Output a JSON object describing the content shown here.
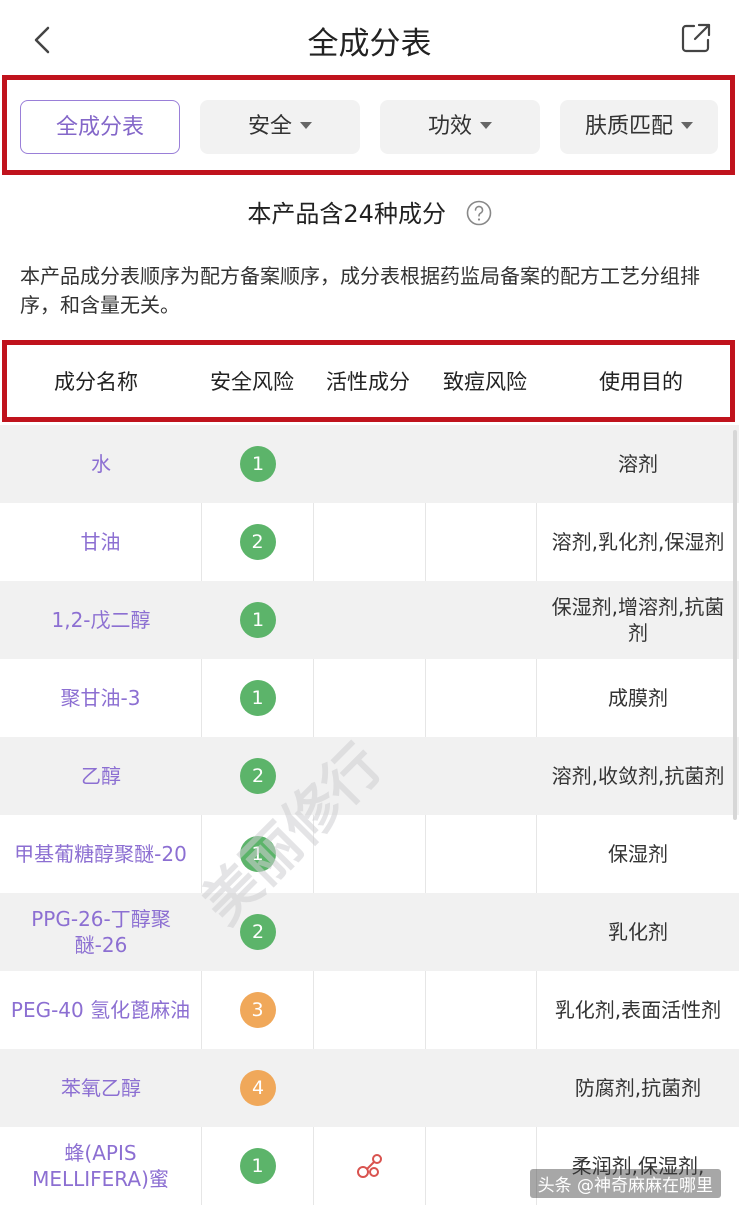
{
  "header": {
    "title": "全成分表"
  },
  "tabs": [
    {
      "label": "全成分表",
      "active": true
    },
    {
      "label": "安全",
      "active": false
    },
    {
      "label": "功效",
      "active": false
    },
    {
      "label": "肤质匹配",
      "active": false
    }
  ],
  "summary": {
    "count_text": "本产品含24种成分"
  },
  "note": "本产品成分表顺序为配方备案顺序，成分表根据药监局备案的配方工艺分组排序，和含量无关。",
  "columns": [
    "成分名称",
    "安全风险",
    "活性成分",
    "致痘风险",
    "使用目的"
  ],
  "rows": [
    {
      "name": "水",
      "safety": "1",
      "purpose": "溶剂"
    },
    {
      "name": "甘油",
      "safety": "2",
      "purpose": "溶剂,乳化剂,保湿剂"
    },
    {
      "name": "1,2-戊二醇",
      "safety": "1",
      "purpose": "保湿剂,增溶剂,抗菌剂"
    },
    {
      "name": "聚甘油-3",
      "safety": "1",
      "purpose": "成膜剂"
    },
    {
      "name": "乙醇",
      "safety": "2",
      "purpose": "溶剂,收敛剂,抗菌剂"
    },
    {
      "name": "甲基葡糖醇聚醚-20",
      "safety": "1",
      "purpose": "保湿剂"
    },
    {
      "name": "PPG-26-丁醇聚醚-26",
      "safety": "2",
      "purpose": "乳化剂"
    },
    {
      "name": "PEG-40 氢化蓖麻油",
      "safety": "3",
      "purpose": "乳化剂,表面活性剂"
    },
    {
      "name": "苯氧乙醇",
      "safety": "4",
      "purpose": "防腐剂,抗菌剂"
    },
    {
      "name": "蜂(APIS MELLIFERA)蜜",
      "safety": "1",
      "purpose": "柔润剂,保湿剂,",
      "active": true
    }
  ],
  "colors": {
    "accent": "#8c6fd2",
    "highlight_border": "#c0131d",
    "safe_low": "#5cb46a",
    "safe_mid": "#f0a85a"
  },
  "icons": {
    "back": "chevron-left-icon",
    "share": "share-icon",
    "help": "question-circle-icon",
    "active": "molecule-icon"
  },
  "watermark": "美丽修行",
  "attribution": "头条 @神奇麻麻在哪里"
}
